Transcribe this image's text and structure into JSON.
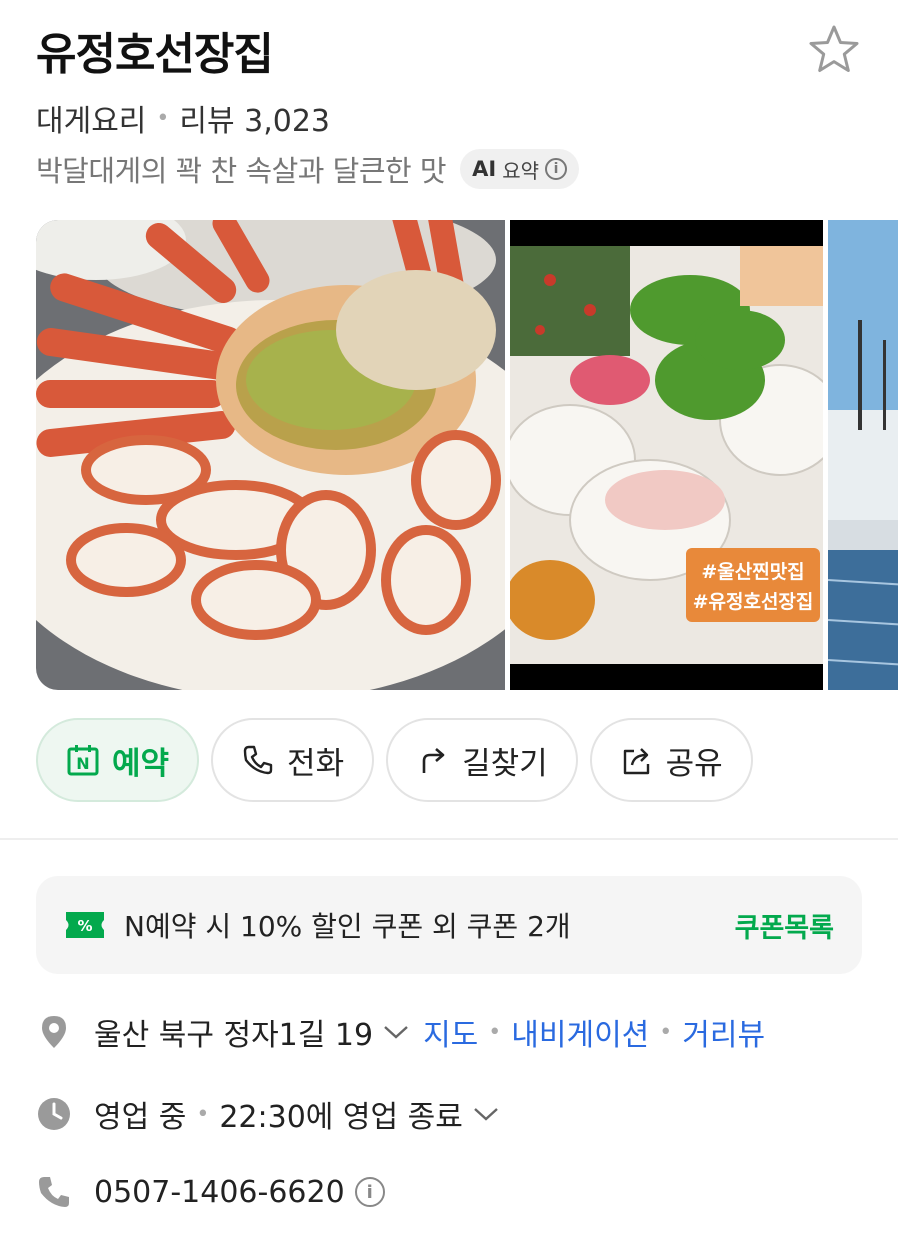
{
  "place": {
    "name": "유정호선장집",
    "category": "대게요리",
    "review_label": "리뷰 3,023",
    "summary": "박달대게의 꽉 찬 속살과 달큰한 맛",
    "ai_badge_prefix": "AI",
    "ai_badge_label": "요약",
    "info_glyph": "i"
  },
  "gallery": {
    "overlay_tags": [
      "#울산찐맛집",
      "#유정호선장집"
    ]
  },
  "actions": [
    {
      "label": "예약",
      "icon": "naver-reserve-icon"
    },
    {
      "label": "전화",
      "icon": "phone-icon"
    },
    {
      "label": "길찾기",
      "icon": "directions-icon"
    },
    {
      "label": "공유",
      "icon": "share-icon"
    }
  ],
  "coupon": {
    "text": "N예약 시 10% 할인 쿠폰 외 쿠폰 2개",
    "link": "쿠폰목록",
    "icon_glyph": "%"
  },
  "address": {
    "text": "울산 북구 정자1길 19",
    "links": [
      "지도",
      "내비게이션",
      "거리뷰"
    ]
  },
  "hours": {
    "status": "영업 중",
    "detail": "22:30에 영업 종료"
  },
  "phone": {
    "number": "0507-1406-6620"
  },
  "colors": {
    "accent_green": "#03a94d",
    "link_blue": "#2a6ae0"
  }
}
